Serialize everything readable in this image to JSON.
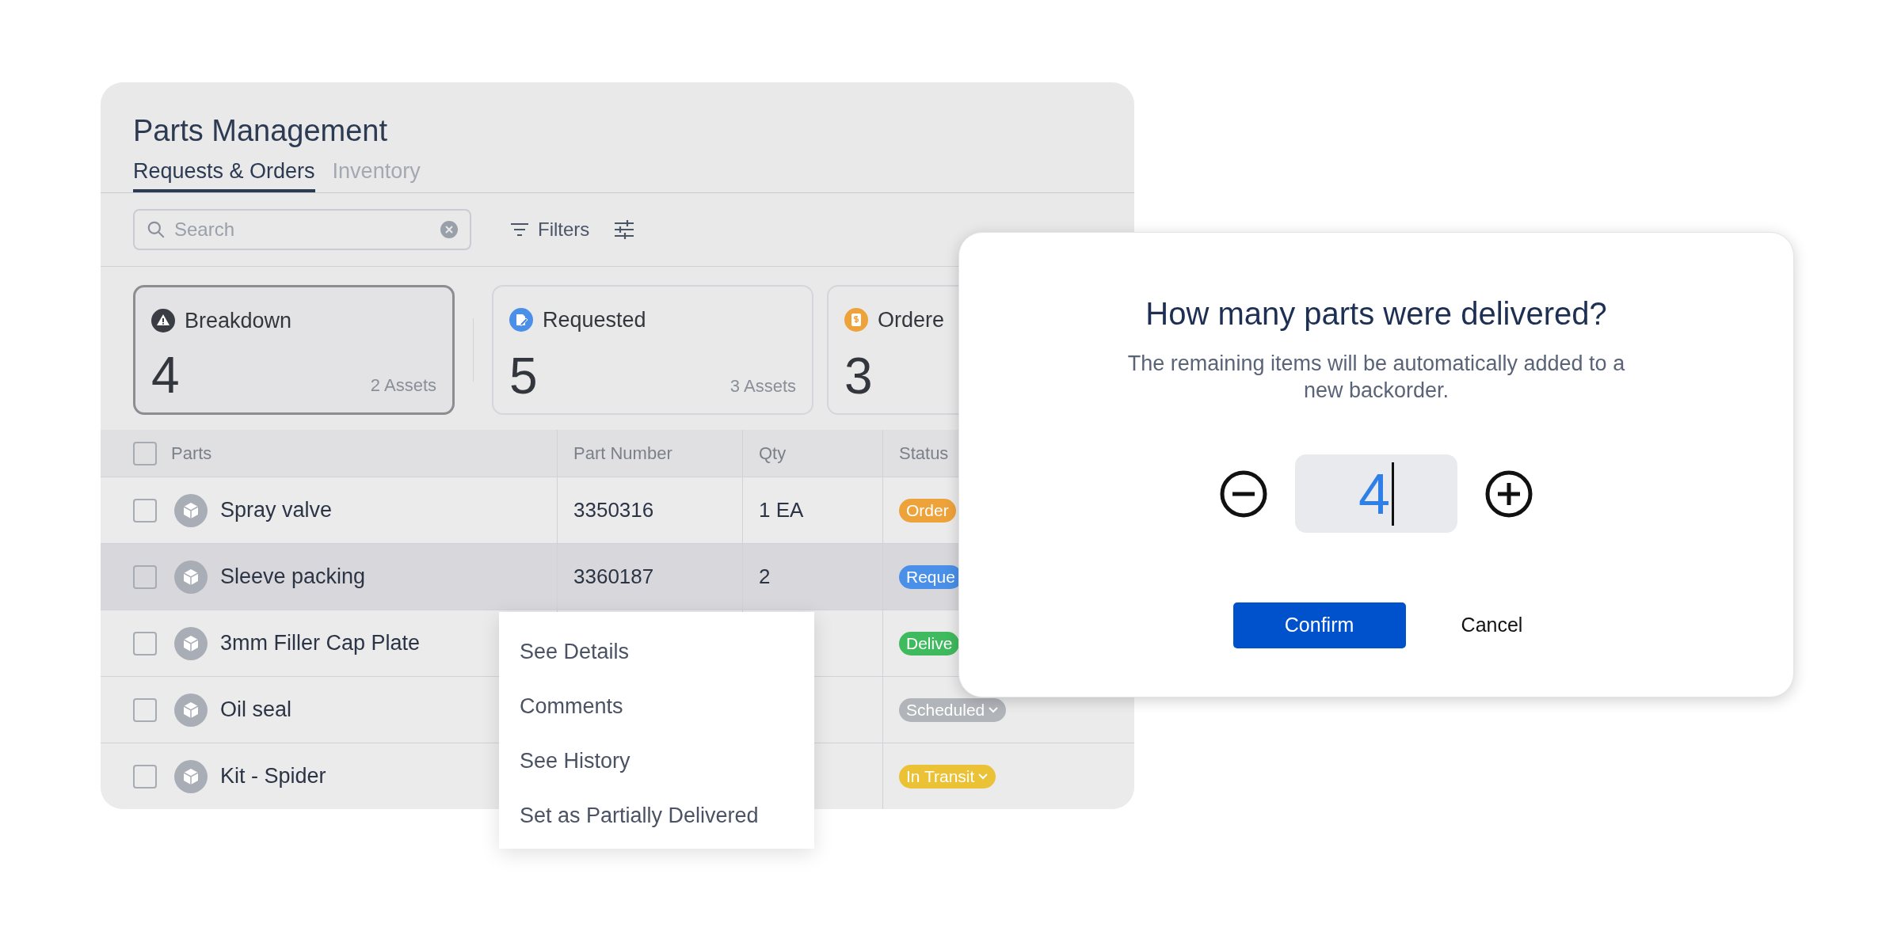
{
  "page_title": "Parts Management",
  "tabs": [
    {
      "label": "Requests & Orders",
      "selected": true
    },
    {
      "label": "Inventory",
      "selected": false
    }
  ],
  "search": {
    "placeholder": "Search"
  },
  "toolbar": {
    "filters": "Filters"
  },
  "summary_cards": [
    {
      "kind": "breakdown",
      "label": "Breakdown",
      "count": "4",
      "assets": "2 Assets",
      "selected": true
    },
    {
      "kind": "requested",
      "label": "Requested",
      "count": "5",
      "assets": "3 Assets",
      "selected": false
    },
    {
      "kind": "ordered",
      "label": "Ordere",
      "count": "3",
      "selected": false
    }
  ],
  "table": {
    "select_all_checked": false,
    "columns": [
      "Parts",
      "Part Number",
      "Qty",
      "Status"
    ],
    "rows": [
      {
        "part": "Spray valve",
        "part_number": "3350316",
        "qty": "1 EA",
        "status": {
          "label": "Order",
          "color": "#eea23a",
          "dropdown": false
        },
        "checked": false,
        "hovered": false
      },
      {
        "part": "Sleeve packing",
        "part_number": "3360187",
        "qty": "2",
        "status": {
          "label": "Reque",
          "color": "#4a8fe8",
          "dropdown": false
        },
        "checked": false,
        "hovered": true
      },
      {
        "part": "3mm Filler Cap Plate",
        "status": {
          "label": "Delive",
          "color": "#3fba5e",
          "dropdown": false
        },
        "checked": false,
        "hovered": false
      },
      {
        "part": "Oil seal",
        "status": {
          "label": "Scheduled",
          "color": "#b1b4b9",
          "dropdown": true
        },
        "checked": false,
        "hovered": false
      },
      {
        "part": "Kit - Spider",
        "status": {
          "label": "In Transit",
          "color": "#ebc135",
          "dropdown": true
        },
        "checked": false,
        "hovered": false
      }
    ]
  },
  "context_menu": {
    "items": [
      "See Details",
      "Comments",
      "See History",
      "Set as Partially Delivered"
    ]
  },
  "dialog": {
    "title": "How many parts were delivered?",
    "message": "The remaining items will be automatically added to a new backorder.",
    "quantity": "4",
    "confirm": "Confirm",
    "cancel": "Cancel"
  }
}
